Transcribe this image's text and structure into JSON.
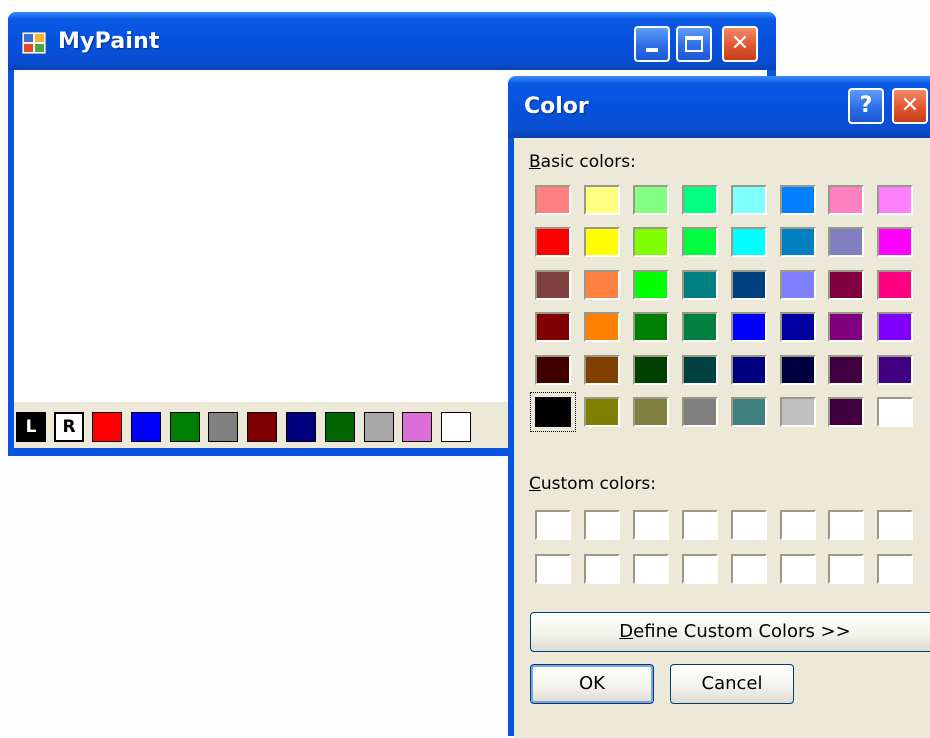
{
  "main_window": {
    "title": "MyPaint",
    "controls": {
      "minimize": "_",
      "maximize": "□",
      "close": "✕"
    },
    "toolbar": {
      "left_label": "L",
      "right_label": "R",
      "swatches": [
        "#ff0000",
        "#0000ff",
        "#008000",
        "#808080",
        "#800000",
        "#000080",
        "#006400",
        "#a9a9a9",
        "#da70d6",
        "#ffffff"
      ]
    }
  },
  "color_dialog": {
    "title": "Color",
    "help": "?",
    "close": "✕",
    "basic_colors_label": {
      "accel": "B",
      "rest": "asic colors:"
    },
    "basic_colors": [
      [
        "#ff8080",
        "#ffff80",
        "#80ff80",
        "#00ff80",
        "#80ffff",
        "#0080ff",
        "#ff80c0",
        "#ff80ff"
      ],
      [
        "#ff0000",
        "#ffff00",
        "#80ff00",
        "#00ff40",
        "#00ffff",
        "#0080c0",
        "#8080c0",
        "#ff00ff"
      ],
      [
        "#804040",
        "#ff8040",
        "#00ff00",
        "#008080",
        "#004080",
        "#8080ff",
        "#800040",
        "#ff0080"
      ],
      [
        "#800000",
        "#ff8000",
        "#008000",
        "#008040",
        "#0000ff",
        "#0000a0",
        "#800080",
        "#8000ff"
      ],
      [
        "#400000",
        "#804000",
        "#004000",
        "#004040",
        "#000080",
        "#000040",
        "#400040",
        "#400080"
      ],
      [
        "#000000",
        "#808000",
        "#808040",
        "#808080",
        "#408080",
        "#c0c0c0",
        "#400040",
        "#ffffff"
      ]
    ],
    "selected_color": "#000000",
    "custom_colors_label": {
      "accel": "C",
      "rest": "ustom colors:"
    },
    "custom_colors": [
      [
        "#ffffff",
        "#ffffff",
        "#ffffff",
        "#ffffff",
        "#ffffff",
        "#ffffff",
        "#ffffff",
        "#ffffff"
      ],
      [
        "#ffffff",
        "#ffffff",
        "#ffffff",
        "#ffffff",
        "#ffffff",
        "#ffffff",
        "#ffffff",
        "#ffffff"
      ]
    ],
    "define_button": {
      "accel": "D",
      "rest": "efine Custom Colors >>"
    },
    "ok_button": "OK",
    "cancel_button": "Cancel"
  }
}
